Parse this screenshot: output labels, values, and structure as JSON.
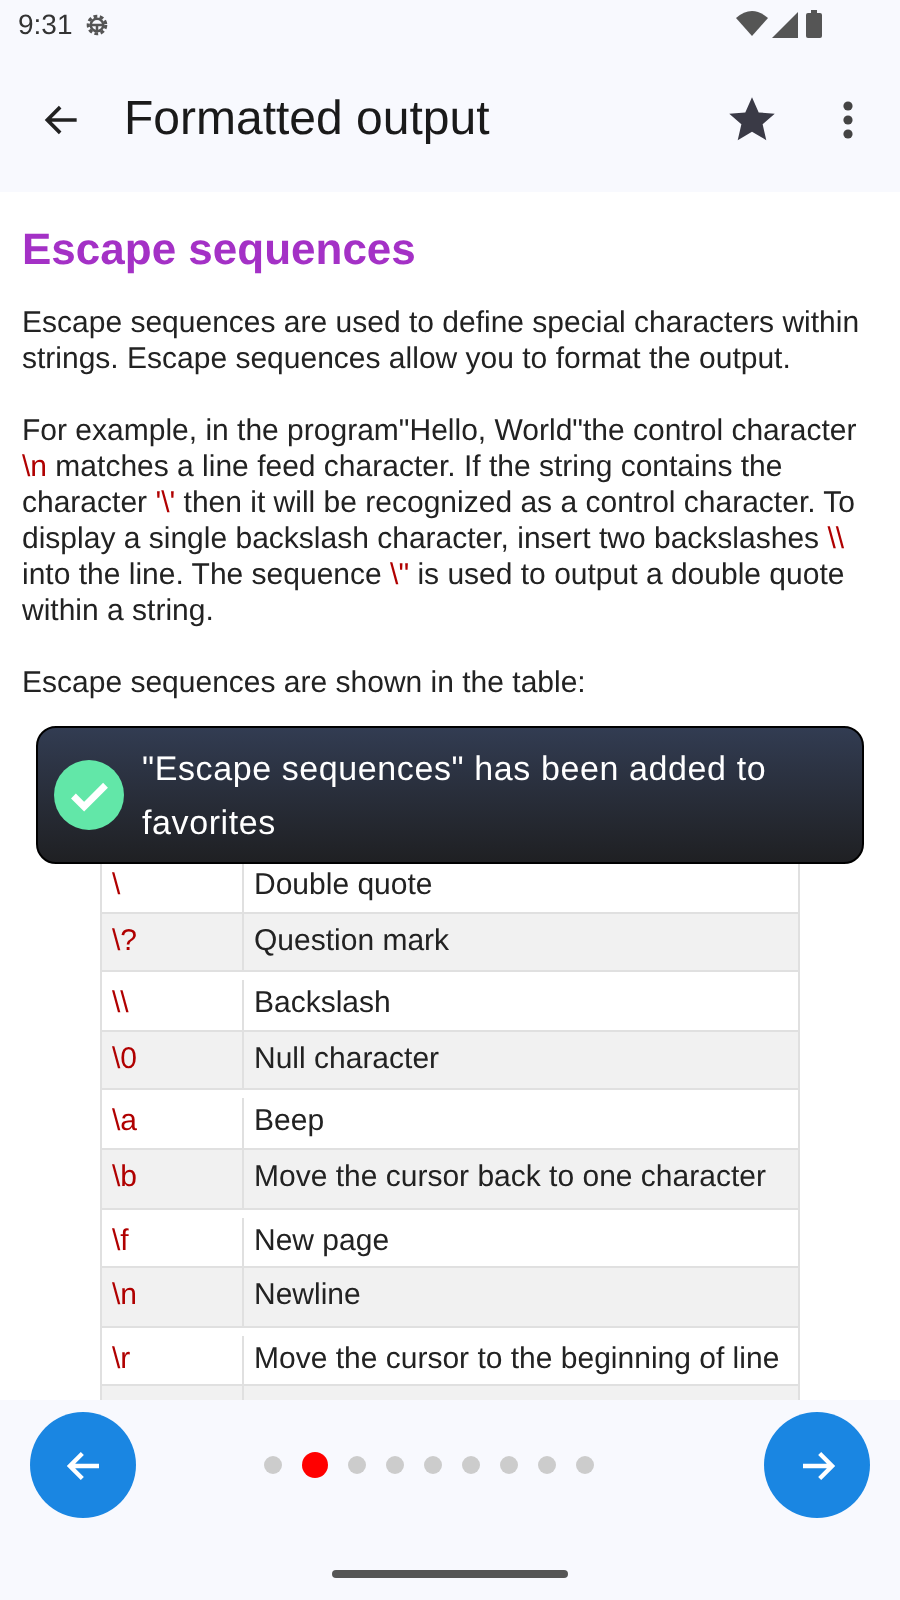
{
  "status_bar": {
    "time": "9:31"
  },
  "app_bar": {
    "title": "Formatted output",
    "favorite": true
  },
  "article": {
    "heading": "Escape sequences",
    "paragraphs": [
      [
        {
          "kind": "text",
          "text": "Escape sequences are used to define special characters within strings. Escape sequences allow you to format the output."
        }
      ],
      [
        {
          "kind": "text",
          "text": "For example, in the program\"Hello, World\"the control character "
        },
        {
          "kind": "code",
          "text": "\\n"
        },
        {
          "kind": "text",
          "text": " matches a line feed character. If the string contains the character "
        },
        {
          "kind": "code",
          "text": "'\\'"
        },
        {
          "kind": "text",
          "text": " then it will be recognized as a control character. To display a single backslash character, insert two backslashes "
        },
        {
          "kind": "code",
          "text": "\\\\"
        },
        {
          "kind": "text",
          "text": " into the line. The sequence "
        },
        {
          "kind": "code",
          "text": "\\\""
        },
        {
          "kind": "text",
          "text": " is used to output a double quote within a string."
        }
      ],
      [
        {
          "kind": "text",
          "text": "Escape sequences are shown in the table:"
        }
      ]
    ],
    "table": {
      "rows": [
        {
          "code": "\\",
          "meaning": "Double quote"
        },
        {
          "code": "\\?",
          "meaning": "Question mark"
        },
        {
          "code": "\\\\",
          "meaning": "Backslash"
        },
        {
          "code": "\\0",
          "meaning": "Null character"
        },
        {
          "code": "\\a",
          "meaning": "Beep"
        },
        {
          "code": "\\b",
          "meaning": "Move the cursor back to one character"
        },
        {
          "code": "\\f",
          "meaning": "New page"
        },
        {
          "code": "\\n",
          "meaning": "Newline"
        },
        {
          "code": "\\r",
          "meaning": "Move the cursor to the beginning of line"
        }
      ]
    }
  },
  "toast": {
    "message": "\"Escape sequences\" has been added to favorites"
  },
  "pager": {
    "pages": [
      {
        "selected": false
      },
      {
        "selected": true
      },
      {
        "selected": false
      },
      {
        "selected": false
      },
      {
        "selected": false
      },
      {
        "selected": false
      },
      {
        "selected": false
      },
      {
        "selected": false
      },
      {
        "selected": false
      }
    ]
  }
}
